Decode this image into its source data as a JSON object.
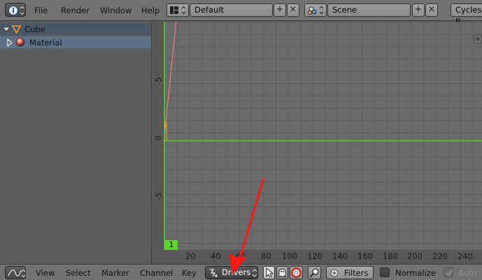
{
  "top_header": {
    "menus": [
      "File",
      "Render",
      "Window",
      "Help"
    ],
    "layout_name": "Default",
    "scene_name": "Scene",
    "render_engine": "Cycles R"
  },
  "outliner": {
    "items": [
      {
        "label": "Cube",
        "icon": "object-triangle-icon",
        "expanded": true
      },
      {
        "label": "Material",
        "icon": "material-sphere-icon",
        "expanded": false
      }
    ]
  },
  "graph": {
    "v_ticks": [
      "5",
      "0",
      "-5"
    ],
    "h_ticks": [
      "20",
      "40",
      "60",
      "80",
      "100",
      "120",
      "140",
      "160",
      "180",
      "200",
      "220",
      "240"
    ],
    "current_frame": "1"
  },
  "bottom_header": {
    "menus": [
      "View",
      "Select",
      "Marker",
      "Channel",
      "Key"
    ],
    "mode": "Drivers",
    "filters_label": "Filters",
    "normalize_label": "Normalize",
    "auto_label": "Auto"
  },
  "colors": {
    "accent_green": "#5fd32d",
    "cursor_green": "#55c33a",
    "annotation_red": "#ff1a1a",
    "key_orange": "#e0a020"
  }
}
